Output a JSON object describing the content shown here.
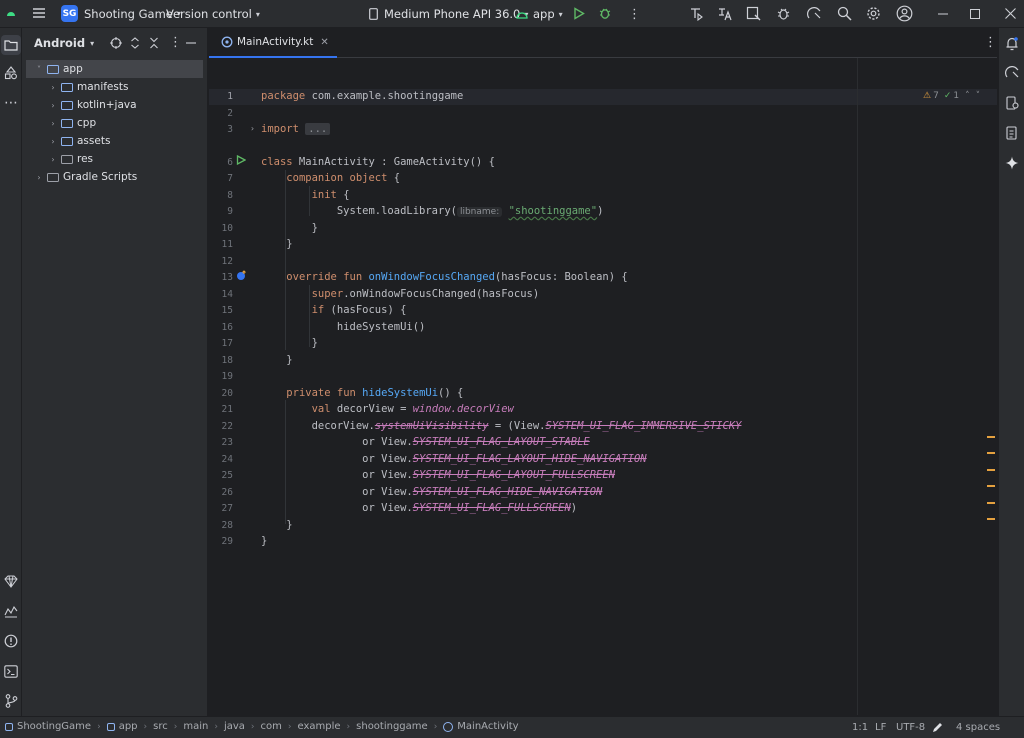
{
  "titlebar": {
    "project_badge": "SG",
    "project_name": "Shooting Game",
    "vcs": "Version control",
    "device": "Medium Phone API 36.0",
    "run_config": "app"
  },
  "project_panel": {
    "view": "Android",
    "tree": [
      {
        "label": "app",
        "depth": 0,
        "expanded": true,
        "selected": true
      },
      {
        "label": "manifests",
        "depth": 1
      },
      {
        "label": "kotlin+java",
        "depth": 1
      },
      {
        "label": "cpp",
        "depth": 1
      },
      {
        "label": "assets",
        "depth": 1
      },
      {
        "label": "res",
        "depth": 1
      },
      {
        "label": "Gradle Scripts",
        "depth": 0
      }
    ]
  },
  "editor": {
    "tab": "MainActivity.kt",
    "warnings": "7",
    "checks": "1",
    "line_numbers": [
      "1",
      "2",
      "3",
      "6",
      "7",
      "8",
      "9",
      "10",
      "11",
      "12",
      "13",
      "14",
      "15",
      "16",
      "17",
      "18",
      "19",
      "20",
      "21",
      "22",
      "23",
      "24",
      "25",
      "26",
      "27",
      "28",
      "29"
    ],
    "code": {
      "l1_kw": "package",
      "l1_rest": " com.example.shootinggame",
      "l3_kw": "import",
      "l3_fold": "...",
      "l6_kw": "class",
      "l6_rest": " MainActivity : GameActivity() {",
      "l7_kw": "companion object",
      "l7_rest": " {",
      "l8_kw": "init",
      "l8_rest": " {",
      "l9_a": "System.loadLibrary(",
      "l9_hint": "libname:",
      "l9_str": "\"shootinggame\"",
      "l9_b": ")",
      "l10": "}",
      "l11": "}",
      "l13_kw": "override fun",
      "l13_fn": "onWindowFocusChanged",
      "l13_rest": "(hasFocus: Boolean) {",
      "l14_kw": "super",
      "l14_rest": ".onWindowFocusChanged(hasFocus)",
      "l15_kw": "if",
      "l15_rest": " (hasFocus) {",
      "l16": "hideSystemUi()",
      "l17": "}",
      "l18": "}",
      "l20_kw": "private fun",
      "l20_fn": "hideSystemUi",
      "l20_rest": "() {",
      "l21_kw": "val",
      "l21_a": " decorView = ",
      "l21_prop": "window.decorView",
      "l22_a": "decorView.",
      "l22_prop": "systemUiVisibility",
      "l22_b": " = (View.",
      "l22_c": "SYSTEM_UI_FLAG_IMMERSIVE_STICKY",
      "l23_a": "or View.",
      "l23_c": "SYSTEM_UI_FLAG_LAYOUT_STABLE",
      "l24_a": "or View.",
      "l24_c": "SYSTEM_UI_FLAG_LAYOUT_HIDE_NAVIGATION",
      "l25_a": "or View.",
      "l25_c": "SYSTEM_UI_FLAG_LAYOUT_FULLSCREEN",
      "l26_a": "or View.",
      "l26_c": "SYSTEM_UI_FLAG_HIDE_NAVIGATION",
      "l27_a": "or View.",
      "l27_c": "SYSTEM_UI_FLAG_FULLSCREEN",
      "l27_b": ")",
      "l28": "}",
      "l29": "}"
    }
  },
  "statusbar": {
    "breadcrumb": [
      "ShootingGame",
      "app",
      "src",
      "main",
      "java",
      "com",
      "example",
      "shootinggame",
      "MainActivity"
    ],
    "position": "1:1",
    "line_sep": "LF",
    "encoding": "UTF-8",
    "indent": "4 spaces"
  },
  "colors": {
    "accent": "#3574f0",
    "keyword": "#cf8e6d",
    "function": "#56a8f5",
    "string": "#6aab73",
    "property": "#c77dbb",
    "warning": "#e5a13f"
  }
}
